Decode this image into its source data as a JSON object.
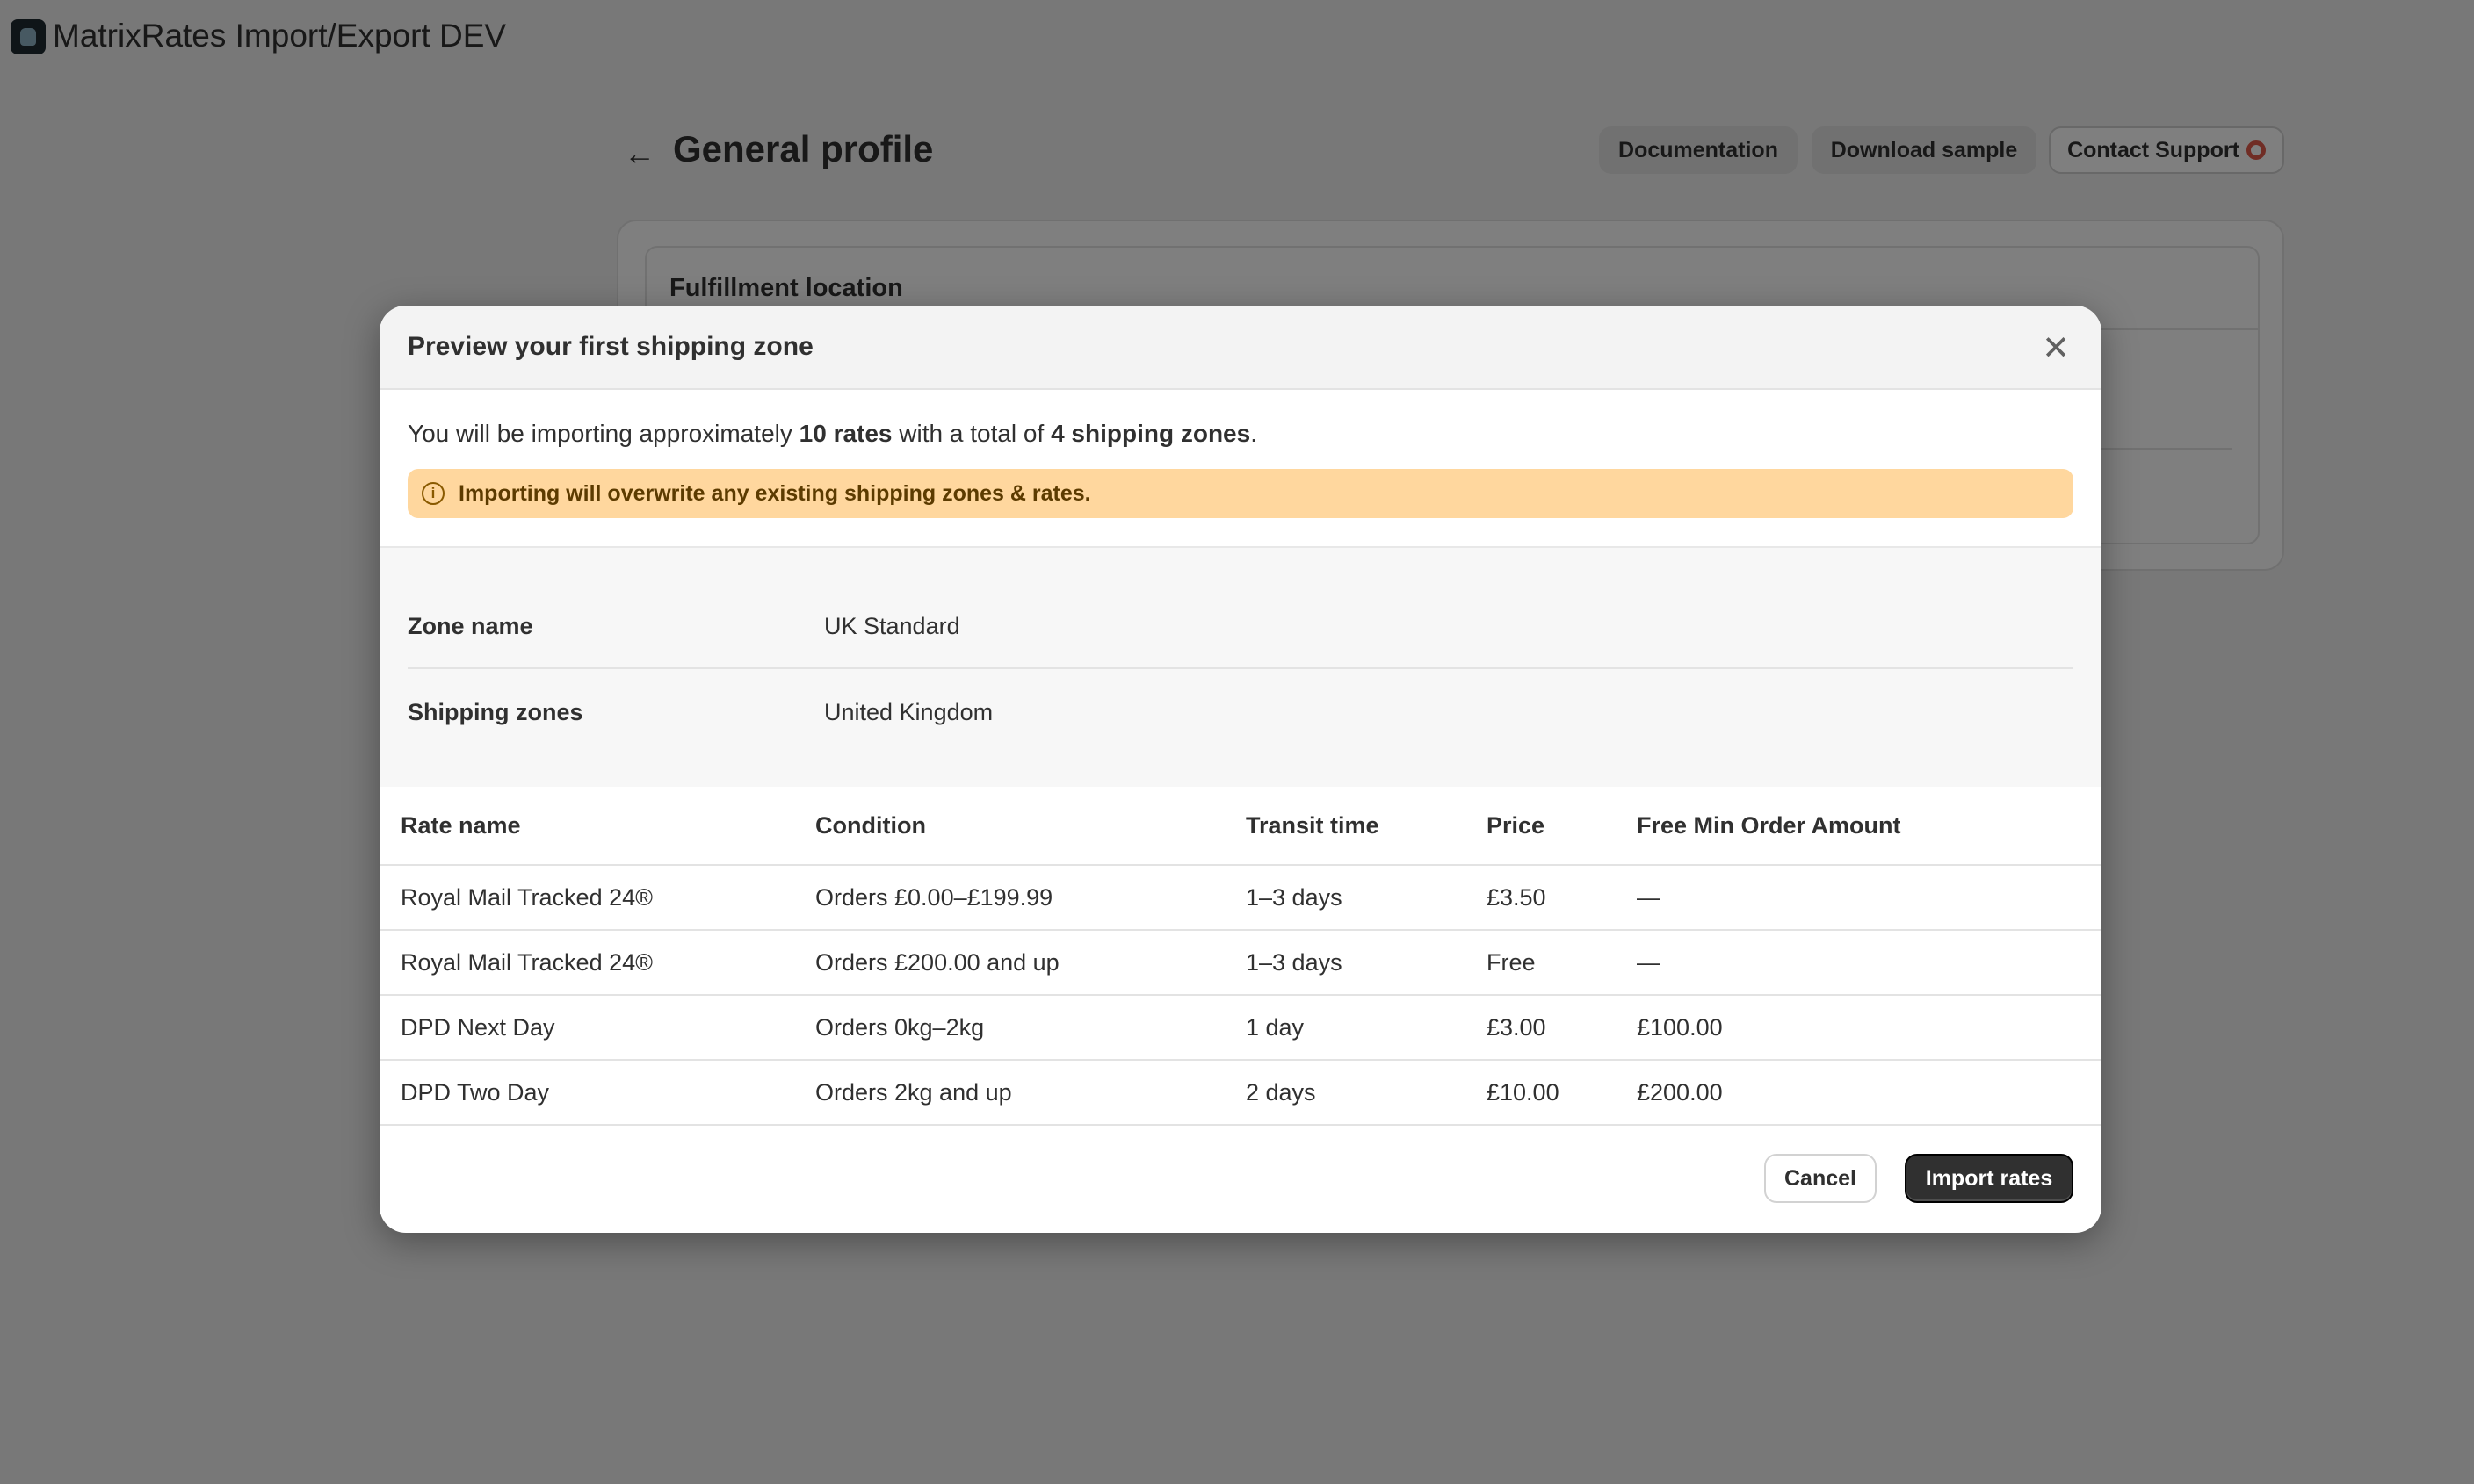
{
  "app": {
    "title": "MatrixRates Import/Export DEV",
    "logo_icon": "app-logo-icon"
  },
  "page": {
    "title": "General profile",
    "back_icon": "arrow-left-icon",
    "actions": {
      "documentation": "Documentation",
      "download_sample": "Download sample",
      "contact_support": "Contact Support",
      "contact_support_icon": "lifebuoy-icon"
    },
    "card": {
      "section_title": "Fulfillment location"
    }
  },
  "modal": {
    "title": "Preview your first shipping zone",
    "close_icon": "close-icon",
    "summary": {
      "prefix": "You will be importing approximately ",
      "rates": "10 rates",
      "middle": " with a total of ",
      "zones": "4 shipping zones",
      "suffix": "."
    },
    "warning": {
      "icon": "info-icon",
      "text": "Importing will overwrite any existing shipping zones & rates."
    },
    "zone": {
      "name_label": "Zone name",
      "name_value": "UK Standard",
      "zones_label": "Shipping zones",
      "zones_value": "United Kingdom"
    },
    "table": {
      "headers": [
        "Rate name",
        "Condition",
        "Transit time",
        "Price",
        "Free Min Order Amount"
      ],
      "rows": [
        [
          "Royal Mail Tracked 24®",
          "Orders £0.00–£199.99",
          "1–3 days",
          "£3.50",
          "—"
        ],
        [
          "Royal Mail Tracked 24®",
          "Orders £200.00 and up",
          "1–3 days",
          "Free",
          "—"
        ],
        [
          "DPD Next Day",
          "Orders 0kg–2kg",
          "1 day",
          "£3.00",
          "£100.00"
        ],
        [
          "DPD Two Day",
          "Orders 2kg and up",
          "2 days",
          "£10.00",
          "£200.00"
        ]
      ]
    },
    "buttons": {
      "cancel": "Cancel",
      "import": "Import rates"
    }
  },
  "colors": {
    "overlay": "#000000",
    "warning_bg": "#ffd79e",
    "primary_button": "#303030"
  }
}
